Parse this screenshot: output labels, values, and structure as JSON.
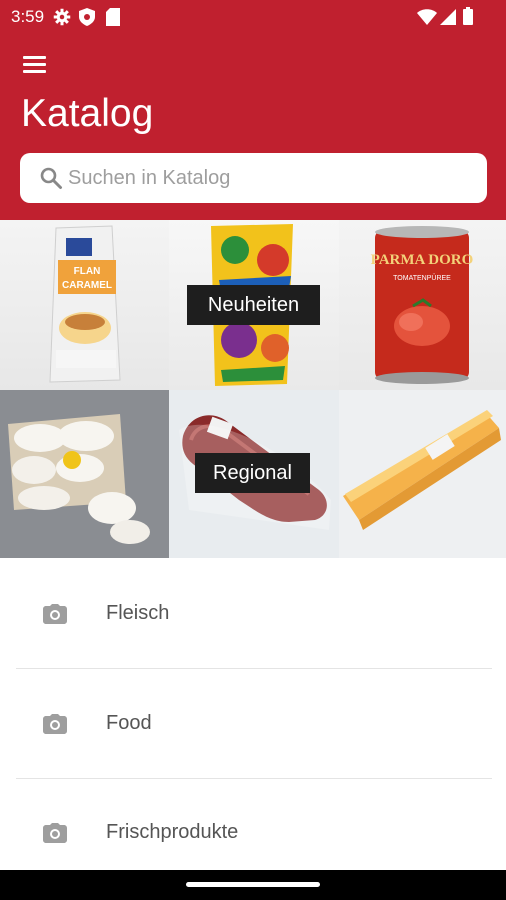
{
  "status_bar": {
    "time": "3:59",
    "left_icons": [
      "gear-icon",
      "shield-icon",
      "sd-card-icon"
    ],
    "right_icons": [
      "wifi-icon",
      "signal-icon",
      "battery-icon"
    ]
  },
  "app_bar": {
    "menu_icon": "hamburger-icon",
    "title": "Katalog",
    "search": {
      "placeholder": "Suchen in Katalog",
      "value": ""
    }
  },
  "featured": [
    {
      "label": "Neuheiten",
      "images": [
        "flan-caramel-bag",
        "colorful-snack-bag",
        "parma-doro-tomato-can"
      ]
    },
    {
      "label": "Regional",
      "images": [
        "meringues-box",
        "salami-sausage",
        "cheese-block"
      ]
    }
  ],
  "product_texts": {
    "flan_brand": "FLAN",
    "flan_name": "CARAMEL",
    "can_brand": "PARMA DORO",
    "can_name": "TOMATENPÜREE"
  },
  "categories": [
    {
      "label": "Fleisch",
      "icon": "camera-icon"
    },
    {
      "label": "Food",
      "icon": "camera-icon"
    },
    {
      "label": "Frischprodukte",
      "icon": "camera-icon"
    }
  ],
  "colors": {
    "brand": "#c0202f",
    "tag_bg": "#1e1e1e",
    "divider": "#e4e4e4"
  }
}
